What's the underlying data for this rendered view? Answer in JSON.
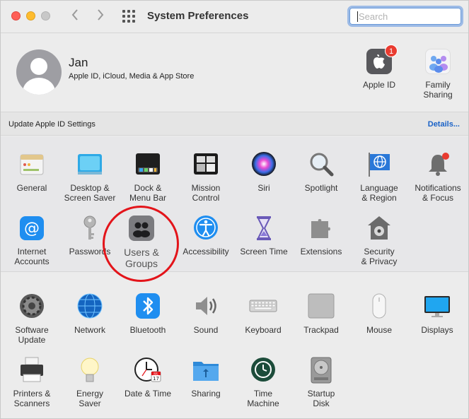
{
  "window": {
    "title": "System Preferences"
  },
  "search": {
    "placeholder": "Search"
  },
  "account": {
    "name": "Jan",
    "subtitle": "Apple ID, iCloud, Media & App Store",
    "apple_id_label": "Apple ID",
    "apple_id_badge": "1",
    "family_label_1": "Family",
    "family_label_2": "Sharing"
  },
  "update_bar": {
    "text": "Update Apple ID Settings",
    "link": "Details..."
  },
  "row1": [
    {
      "l1": "General",
      "l2": "",
      "icon": "general-icon"
    },
    {
      "l1": "Desktop &",
      "l2": "Screen Saver",
      "icon": "desktop-icon"
    },
    {
      "l1": "Dock &",
      "l2": "Menu Bar",
      "icon": "dock-icon"
    },
    {
      "l1": "Mission",
      "l2": "Control",
      "icon": "mission-control-icon"
    },
    {
      "l1": "Siri",
      "l2": "",
      "icon": "siri-icon"
    },
    {
      "l1": "Spotlight",
      "l2": "",
      "icon": "spotlight-icon"
    },
    {
      "l1": "Language",
      "l2": "& Region",
      "icon": "language-icon"
    },
    {
      "l1": "Notifications",
      "l2": "& Focus",
      "icon": "notifications-icon"
    }
  ],
  "row2": [
    {
      "l1": "Internet",
      "l2": "Accounts",
      "icon": "at-icon"
    },
    {
      "l1": "Passwords",
      "l2": "",
      "icon": "key-icon"
    },
    {
      "l1": "Users &",
      "l2": "Groups",
      "icon": "users-icon"
    },
    {
      "l1": "Accessibility",
      "l2": "",
      "icon": "accessibility-icon"
    },
    {
      "l1": "Screen Time",
      "l2": "",
      "icon": "hourglass-icon"
    },
    {
      "l1": "Extensions",
      "l2": "",
      "icon": "puzzle-icon"
    },
    {
      "l1": "Security",
      "l2": "& Privacy",
      "icon": "lock-house-icon"
    }
  ],
  "row3": [
    {
      "l1": "Software",
      "l2": "Update",
      "icon": "gear-icon"
    },
    {
      "l1": "Network",
      "l2": "",
      "icon": "globe-icon"
    },
    {
      "l1": "Bluetooth",
      "l2": "",
      "icon": "bluetooth-icon"
    },
    {
      "l1": "Sound",
      "l2": "",
      "icon": "speaker-icon"
    },
    {
      "l1": "Keyboard",
      "l2": "",
      "icon": "keyboard-icon"
    },
    {
      "l1": "Trackpad",
      "l2": "",
      "icon": "trackpad-icon"
    },
    {
      "l1": "Mouse",
      "l2": "",
      "icon": "mouse-icon"
    },
    {
      "l1": "Displays",
      "l2": "",
      "icon": "display-icon"
    }
  ],
  "row4": [
    {
      "l1": "Printers &",
      "l2": "Scanners",
      "icon": "printer-icon"
    },
    {
      "l1": "Energy",
      "l2": "Saver",
      "icon": "bulb-icon"
    },
    {
      "l1": "Date & Time",
      "l2": "",
      "icon": "clock-icon",
      "cal_month": "JUL",
      "cal_day": "17"
    },
    {
      "l1": "Sharing",
      "l2": "",
      "icon": "folder-icon"
    },
    {
      "l1": "Time",
      "l2": "Machine",
      "icon": "time-machine-icon"
    },
    {
      "l1": "Startup",
      "l2": "Disk",
      "icon": "disk-icon"
    }
  ]
}
